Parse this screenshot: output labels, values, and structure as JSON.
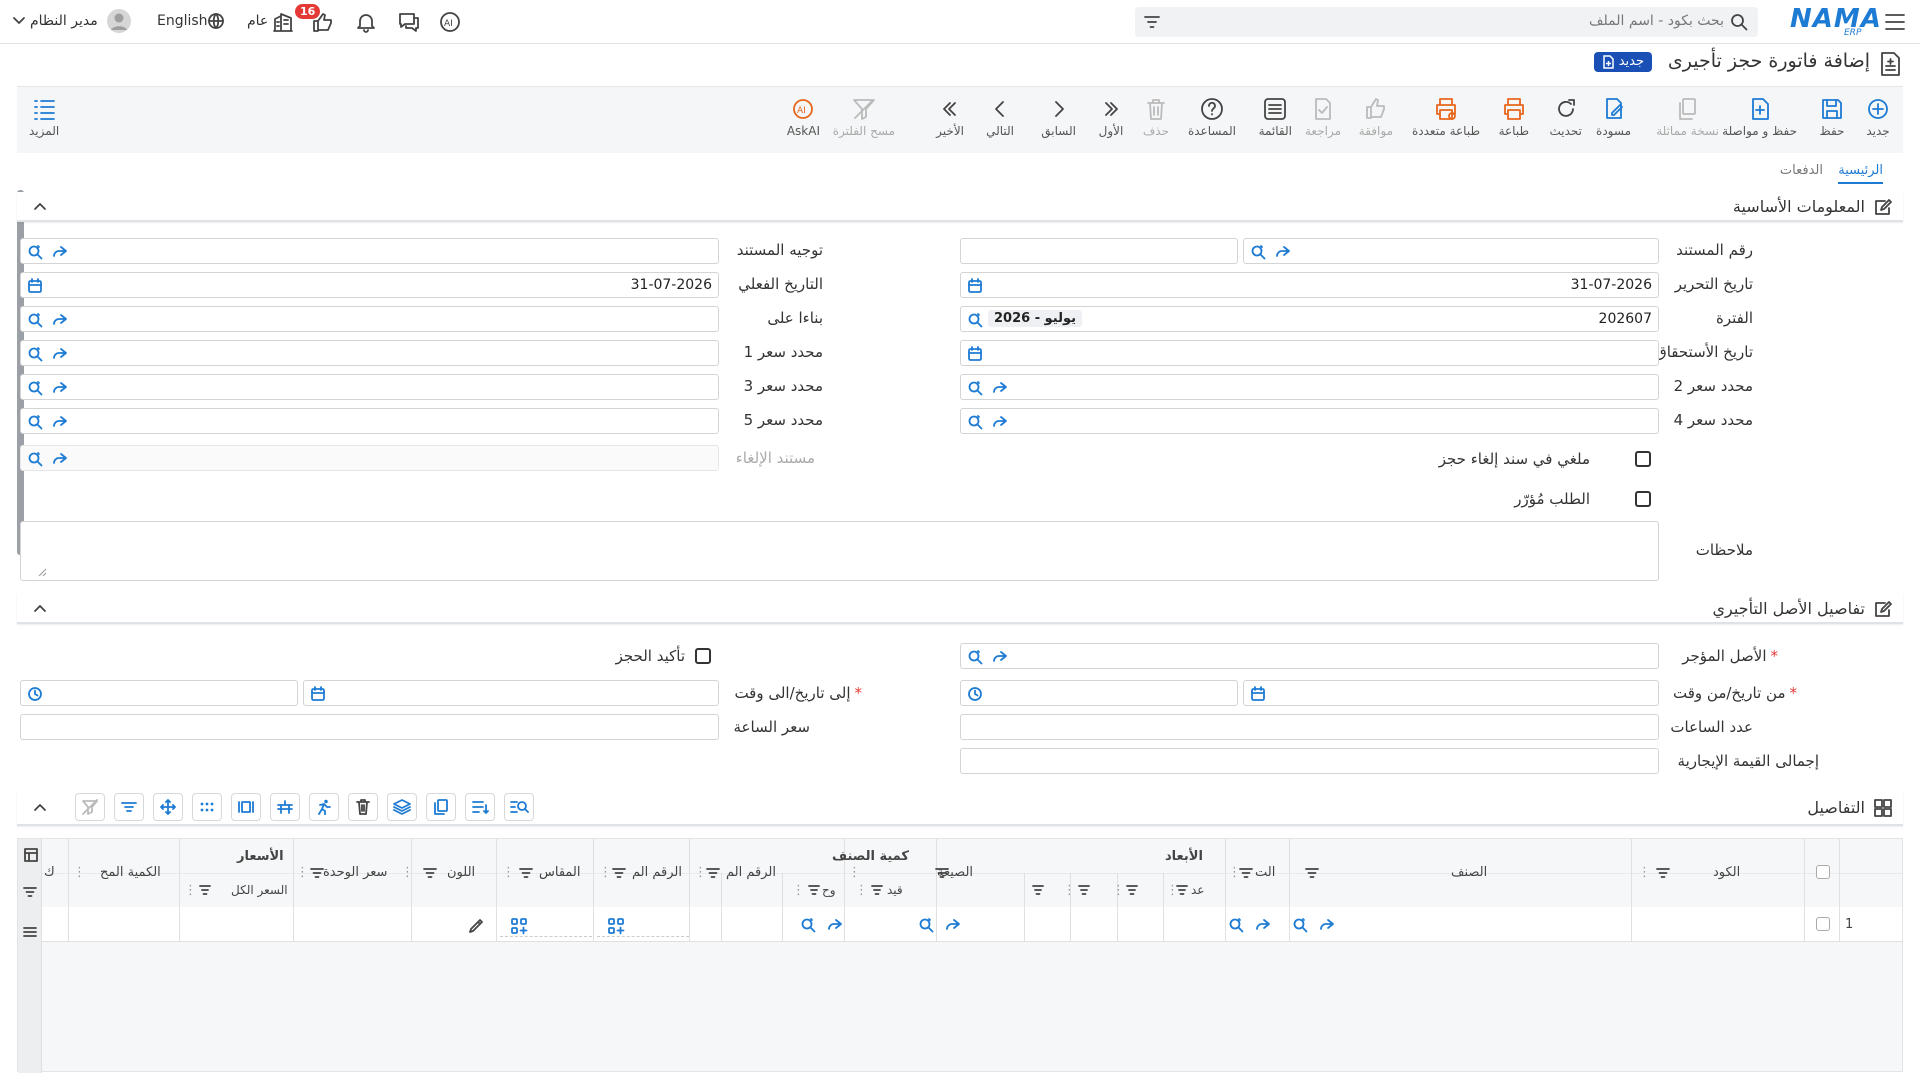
{
  "topbar": {
    "search_placeholder": "بحث بكود - اسم الملف",
    "user_name": "مدير النظام",
    "language": "English",
    "scope": "عام",
    "notification_count": "16",
    "logo": "NAMA",
    "logo_sub": "ERP"
  },
  "page": {
    "title": "إضافة فاتورة حجز تأجيرى",
    "status_badge": "جديد"
  },
  "toolbar": {
    "new": "جديد",
    "save": "حفظ",
    "save_continue": "حفظ و مواصلة",
    "duplicate": "نسخة مماثلة",
    "draft": "مسودة",
    "refresh": "تحديث",
    "print": "طباعة",
    "multi_print": "طباعة متعددة",
    "approve": "موافقة",
    "review": "مراجعة",
    "list": "القائمة",
    "help": "المساعدة",
    "delete": "حذف",
    "first": "الأول",
    "previous": "السابق",
    "next": "التالي",
    "last": "الأخير",
    "clear_filter": "مسح الفلترة",
    "askai": "AskAI",
    "more": "المزيد"
  },
  "tabs": {
    "main": "الرئيسية",
    "payments": "الدفعات"
  },
  "basic_info": {
    "title": "المعلومات الأساسية",
    "doc_number_label": "رقم المستند",
    "doc_direction_label": "توجيه المستند",
    "edit_date_label": "تاريخ التحرير",
    "edit_date_value": "31-07-2026",
    "actual_date_label": "التاريخ الفعلي",
    "actual_date_value": "31-07-2026",
    "period_label": "الفترة",
    "period_value": "202607",
    "period_chip": "2026 - يوليو",
    "based_on_label": "بناءا على",
    "due_date_label": "تاريخ الأستحقاق",
    "price_1_label": "محدد سعر 1",
    "price_2_label": "محدد سعر 2",
    "price_3_label": "محدد سعر 3",
    "price_4_label": "محدد سعر 4",
    "price_5_label": "محدد سعر 5",
    "cancelled_label": "ملغي في سند إلغاء حجز",
    "cancel_doc_label": "مستند الإلغاء",
    "archived_label": "الطلب مُؤرّر",
    "notes_label": "ملاحظات"
  },
  "asset_details": {
    "title": "تفاصيل الأصل التأجيري",
    "asset_label": "الأصل المؤجر",
    "confirm_label": "تأكيد الحجز",
    "from_label": "من تاريخ/من وقت",
    "to_label": "إلى تاريخ/الى وقت",
    "hours_label": "عدد الساعات",
    "hour_price_label": "سعر الساعة",
    "total_label": "إجمالى القيمة الإيجارية"
  },
  "details": {
    "title": "التفاصيل",
    "columns": {
      "code": "الكود",
      "item": "الصنف",
      "t": "الت",
      "dimensions": "الأبعاد",
      "count": "عد",
      "formula": "الصيغة",
      "item_qty": "كمية الصنف",
      "unit": "وح",
      "restricted": "قيد",
      "serial_1": "الرقم الم",
      "serial_2": "الرقم الم",
      "size": "المقاس",
      "color": "اللون",
      "unit_price": "سعر الوحدة",
      "prices": "الأسعار",
      "total_price": "السعر الكل",
      "qty_shown": "الكمية المح",
      "k": "ك"
    },
    "rows": [
      {
        "index": "1"
      }
    ]
  }
}
